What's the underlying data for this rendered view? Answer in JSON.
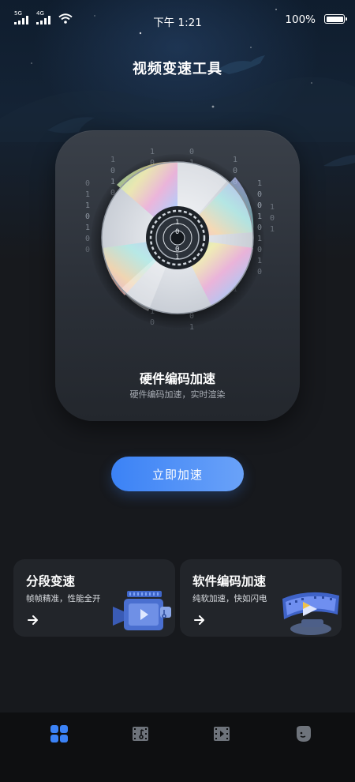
{
  "status_bar": {
    "net_1": "5G",
    "net_2": "4G",
    "time": "下午 1:21",
    "battery": "100%"
  },
  "header": {
    "title": "视频变速工具"
  },
  "hero": {
    "title": "硬件编码加速",
    "subtitle": "硬件编码加速，实时渲染"
  },
  "cta": {
    "label": "立即加速"
  },
  "features": [
    {
      "title": "分段变速",
      "subtitle": "帧帧精准，性能全开"
    },
    {
      "title": "软件编码加速",
      "subtitle": "纯软加速，快如闪电"
    }
  ],
  "tabbar": {
    "active_color": "#3b82f6",
    "icons": [
      "grid-icon",
      "film-music-icon",
      "film-play-icon",
      "face-icon"
    ]
  },
  "colors": {
    "accent": "#3b82f6",
    "card": "#22252a",
    "background": "#17191d"
  }
}
